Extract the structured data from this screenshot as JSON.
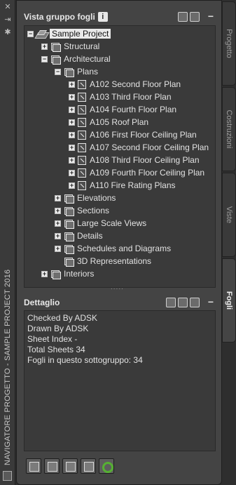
{
  "left_bar": {
    "title": "NAVIGATORE PROGETTO - SAMPLE PROJECT 2016"
  },
  "sheet_set_panel": {
    "title": "Vista gruppo fogli",
    "info_icon": "i"
  },
  "tree": {
    "root": "Sample Project",
    "nodes": {
      "structural": "Structural",
      "architectural": "Architectural",
      "plans": "Plans",
      "sheets": [
        "A102 Second Floor Plan",
        "A103 Third Floor Plan",
        "A104 Fourth Floor Plan",
        "A105 Roof Plan",
        "A106 First Floor Ceiling Plan",
        "A107 Second Floor Ceiling Plan",
        "A108 Third Floor Ceiling Plan",
        "A109 Fourth Floor Ceiling Plan",
        "A110 Fire Rating Plans"
      ],
      "elevations": "Elevations",
      "sections": "Sections",
      "large_scale_views": "Large Scale Views",
      "details": "Details",
      "schedules": "Schedules and Diagrams",
      "representations": "3D Representations",
      "interiors": "Interiors"
    }
  },
  "detail_panel": {
    "title": "Dettaglio",
    "lines": [
      "Checked By ADSK",
      "Drawn By ADSK",
      "Sheet Index -",
      "Total Sheets 34",
      "Fogli in questo sottogruppo: 34"
    ]
  },
  "tabs": [
    "Progetto",
    "Costruzioni",
    "Viste",
    "Fogli"
  ],
  "active_tab": "Fogli",
  "colors": {
    "accent_refresh": "#56b033",
    "selection": "#e9e9e9"
  }
}
